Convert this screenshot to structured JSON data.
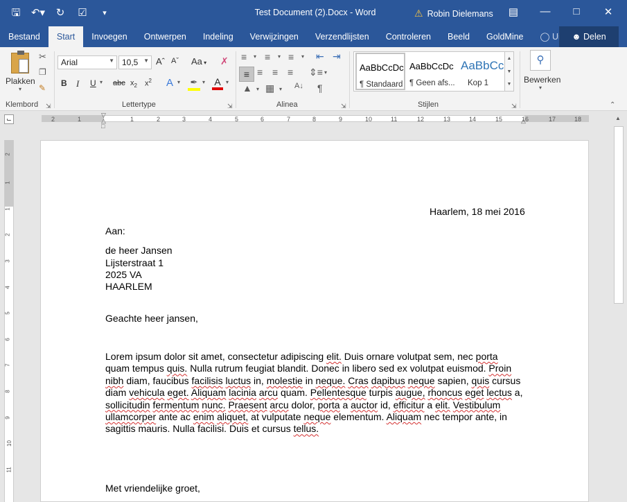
{
  "window": {
    "title": "Test Document (2).Docx - Word",
    "user": "Robin Dielemans"
  },
  "tabs": [
    {
      "label": "Bestand"
    },
    {
      "label": "Start"
    },
    {
      "label": "Invoegen"
    },
    {
      "label": "Ontwerpen"
    },
    {
      "label": "Indeling"
    },
    {
      "label": "Verwijzingen"
    },
    {
      "label": "Verzendlijsten"
    },
    {
      "label": "Controleren"
    },
    {
      "label": "Beeld"
    },
    {
      "label": "GoldMine"
    },
    {
      "label": "Uitleg"
    }
  ],
  "share_label": "Delen",
  "ribbon": {
    "clipboard": {
      "paste_label": "Plakken",
      "group_label": "Klembord"
    },
    "font": {
      "font_name": "Arial",
      "font_size": "10,5",
      "case_label": "Aa",
      "group_label": "Lettertype"
    },
    "paragraph": {
      "group_label": "Alinea"
    },
    "styles": {
      "group_label": "Stijlen",
      "items": [
        {
          "preview": "AaBbCcDc",
          "name": "¶ Standaard"
        },
        {
          "preview": "AaBbCcDc",
          "name": "¶ Geen afs..."
        },
        {
          "preview": "AaBbCc",
          "name": "Kop 1"
        }
      ]
    },
    "editing": {
      "label": "Bewerken"
    }
  },
  "ruler": {
    "numbers": [
      "2",
      "1",
      "1",
      "2",
      "3",
      "4",
      "5",
      "6",
      "7",
      "8",
      "9",
      "10",
      "11",
      "12",
      "13",
      "14",
      "15",
      "16",
      "17",
      "18"
    ]
  },
  "vruler": {
    "numbers": [
      "2",
      "1",
      "1",
      "2",
      "3",
      "4",
      "5",
      "6",
      "7",
      "8",
      "9",
      "10",
      "11"
    ]
  },
  "document": {
    "date": "Haarlem, 18 mei 2016",
    "to_label": "Aan:",
    "recipient": [
      "de heer Jansen",
      "Lijsterstraat 1",
      "2025 VA",
      "HAARLEM"
    ],
    "salutation": "Geachte heer jansen,",
    "body": [
      "Lorem ipsum dolor sit amet, consectetur adipiscing elit. Duis ornare volutpat sem, nec porta",
      "quam tempus quis. Nulla rutrum feugiat blandit. Donec in libero sed ex volutpat euismod. Proin",
      "nibh diam, faucibus facilisis luctus in, molestie in neque. Cras dapibus neque sapien, quis cursus",
      "diam vehicula eget. Aliquam lacinia arcu quam. Pellentesque turpis augue, rhoncus eget lectus a,",
      "sollicitudin fermentum nunc. Praesent arcu dolor, porta a auctor id, efficitur a elit. Vestibulum",
      "ullamcorper ante ac enim aliquet, at vulputate neque elementum. Aliquam nec tempor ante, in",
      "sagittis mauris. Nulla facilisi. Duis et cursus tellus."
    ],
    "closing": "Met vriendelijke groet,"
  },
  "colors": {
    "accent": "#2b579a",
    "highlight": "#ffff00",
    "font_color": "#e00000"
  }
}
